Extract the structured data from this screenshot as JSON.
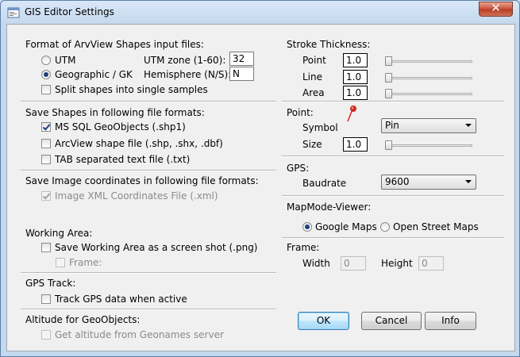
{
  "window": {
    "title": "GIS Editor Settings",
    "close_symbol": "✕"
  },
  "left": {
    "shapes_format": {
      "heading": "Format of ArvView Shapes input files:",
      "utm_label": "UTM",
      "geographic_label": "Geographic / GK",
      "utm_zone_label": "UTM zone (1-60):",
      "utm_zone_value": "32",
      "hemisphere_label": "Hemisphere (N/S):",
      "hemisphere_value": "N",
      "split_label": "Split shapes into single samples",
      "selected": "geographic"
    },
    "save_shapes": {
      "heading": "Save Shapes in following file formats:",
      "mssql_label": "MS SQL GeoObjects (.shp1)",
      "arcview_label": "ArcView shape file (.shp, .shx, .dbf)",
      "tab_label": "TAB separated text file (.txt)"
    },
    "save_image": {
      "heading": "Save Image coordinates in following file formats:",
      "xml_label": "Image XML Coordinates File (.xml)"
    },
    "working_area": {
      "heading": "Working Area:",
      "screenshot_label": "Save Working Area as a screen shot (.png)",
      "frame_label": "Frame:"
    },
    "gps_track": {
      "heading": "GPS Track:",
      "track_label": "Track GPS data when active"
    },
    "altitude": {
      "heading": "Altitude for GeoObjects:",
      "geonames_label": "Get altitude from Geonames server"
    }
  },
  "right": {
    "stroke": {
      "heading": "Stroke Thickness:",
      "point_label": "Point",
      "point_value": "1.0",
      "line_label": "Line",
      "line_value": "1.0",
      "area_label": "Area",
      "area_value": "1.0"
    },
    "point": {
      "heading": "Point:",
      "symbol_label": "Symbol",
      "symbol_value": "Pin",
      "size_label": "Size",
      "size_value": "1.0"
    },
    "gps": {
      "heading": "GPS:",
      "baudrate_label": "Baudrate",
      "baudrate_value": "9600"
    },
    "mapmode": {
      "heading": "MapMode-Viewer:",
      "google_label": "Google Maps",
      "osm_label": "Open Street Maps",
      "selected": "google"
    },
    "frame": {
      "heading": "Frame:",
      "width_label": "Width",
      "width_value": "0",
      "height_label": "Height",
      "height_value": "0"
    }
  },
  "buttons": {
    "ok": "OK",
    "cancel": "Cancel",
    "info": "Info"
  },
  "colors": {
    "accent": "#3c7fb1",
    "pin": "#d42a1e"
  }
}
